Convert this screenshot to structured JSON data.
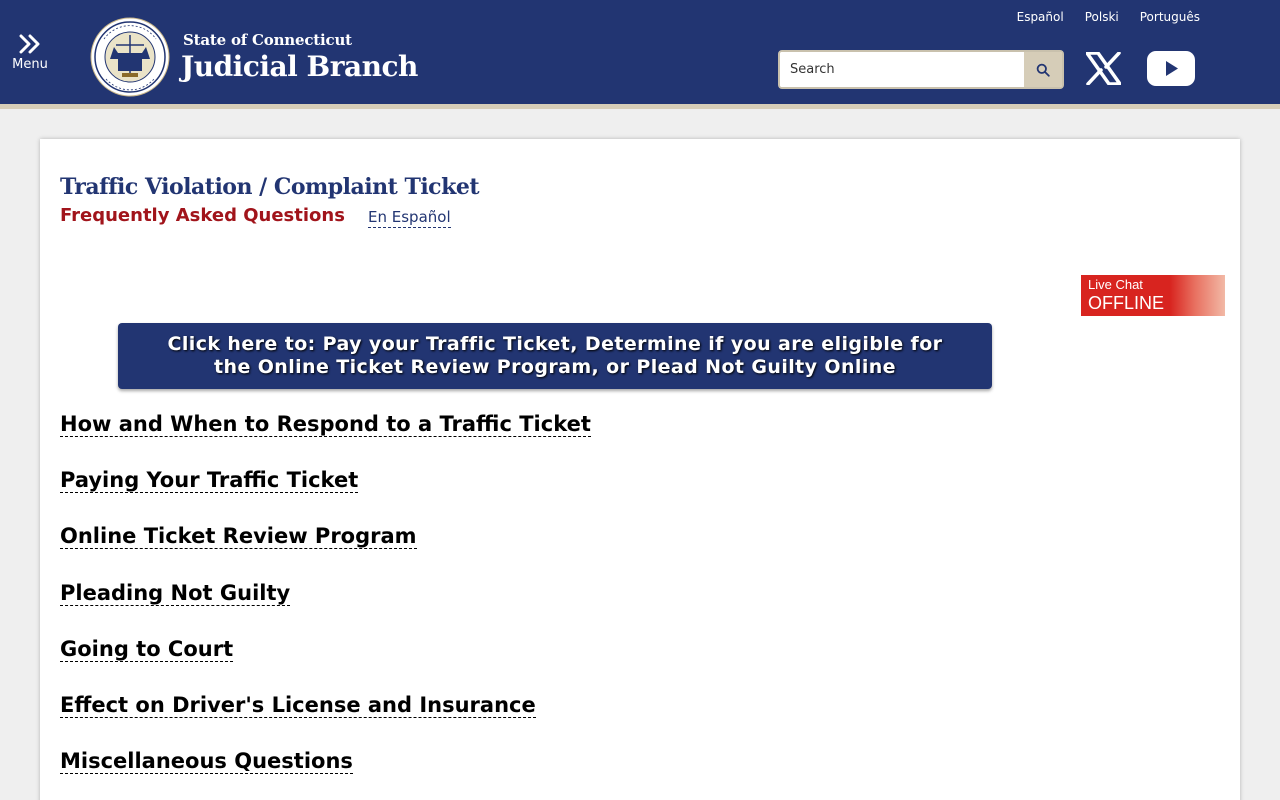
{
  "header": {
    "menu_label": "Menu",
    "brand_top": "State of Connecticut",
    "brand_main": "Judicial Branch",
    "languages": [
      "Español",
      "Polski",
      "Português"
    ],
    "search_placeholder": "Search",
    "colors": {
      "header_bg": "#223572",
      "stripe": "#d6cdb8"
    }
  },
  "main": {
    "title": "Traffic Violation / Complaint Ticket",
    "subtitle": "Frequently Asked Questions",
    "espanol_link": "En Español",
    "live_chat": {
      "line1": "Live Chat",
      "line2": "OFFLINE"
    },
    "cta_button": "Click here to: Pay your Traffic Ticket, Determine if you are eligible for the Online Ticket Review Program, or Plead Not Guilty Online",
    "faq_links": [
      "How and When to Respond to a Traffic Ticket",
      "Paying Your Traffic Ticket",
      "Online Ticket Review Program",
      "Pleading Not Guilty",
      "Going to Court",
      "Effect on Driver's License and Insurance",
      "Miscellaneous Questions"
    ]
  }
}
